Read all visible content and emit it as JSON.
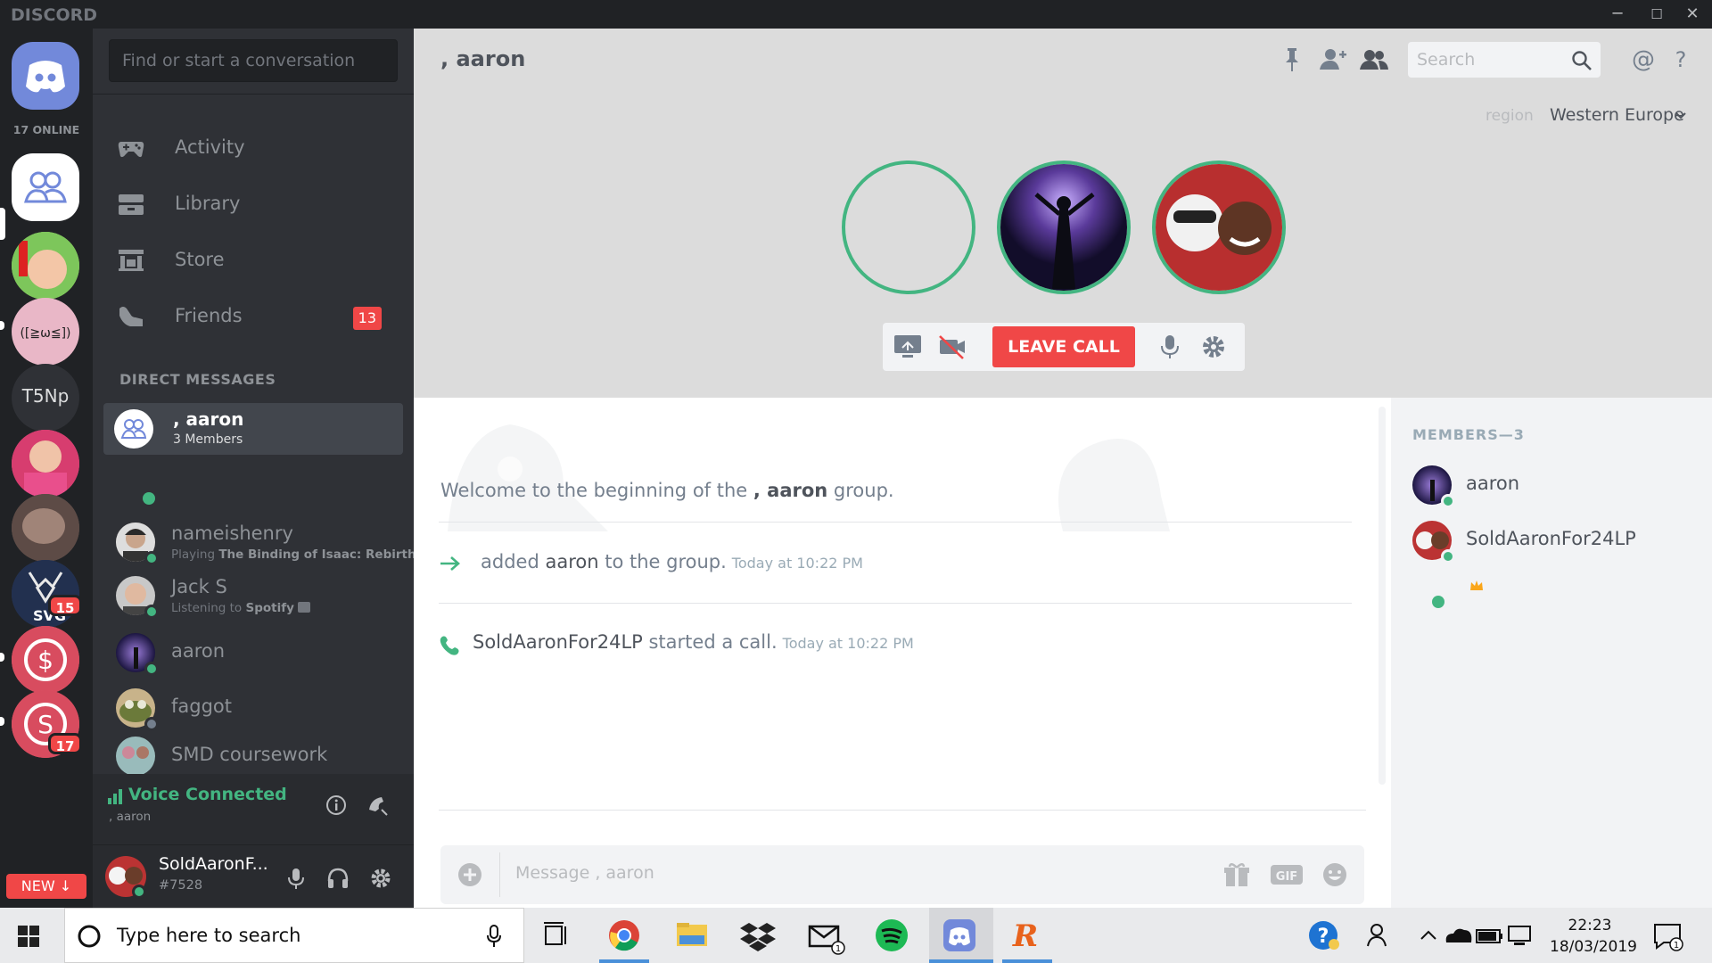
{
  "app": {
    "brand": "DISCORD",
    "online_count": "17 ONLINE"
  },
  "window": {
    "minimize": "─",
    "maximize": "☐",
    "close": "✕"
  },
  "rail": {
    "t5np_label": "T5Np",
    "badge_svg": "15",
    "badge_last": "17",
    "new_label": "NEW ↓"
  },
  "sidebar": {
    "search_placeholder": "Find or start a conversation",
    "nav": [
      {
        "label": "Activity"
      },
      {
        "label": "Library"
      },
      {
        "label": "Store"
      },
      {
        "label": "Friends",
        "count": "13"
      }
    ],
    "dm_heading": "DIRECT MESSAGES",
    "active_dm": {
      "name": ", aaron",
      "sub": "3 Members"
    },
    "dms": [
      {
        "name": "nameishenry",
        "sub_prefix": "Playing ",
        "sub_bold": "The Binding of Isaac: Rebirth",
        "status": "#43b581"
      },
      {
        "name": "Jack S",
        "sub_prefix": "Listening to ",
        "sub_bold": "Spotify",
        "status": "#43b581"
      },
      {
        "name": "aaron",
        "status": "#43b581"
      },
      {
        "name": "faggot",
        "status": "#747f8d"
      },
      {
        "name": "SMD coursework"
      }
    ]
  },
  "voice": {
    "status": "Voice Connected",
    "channel": ", aaron"
  },
  "user": {
    "name": "SoldAaronF...",
    "tag": "#7528"
  },
  "call": {
    "title": ", aaron",
    "search_placeholder": "Search",
    "region_label": "region",
    "region_value": "Western Europe",
    "leave_label": "LEAVE CALL"
  },
  "chat": {
    "welcome_prefix": "Welcome to the beginning of the ",
    "welcome_group": ", aaron",
    "welcome_suffix": " group.",
    "messages": [
      {
        "prefix": "added ",
        "who": "aaron",
        "text": " to the group.",
        "time": "Today at 10:22 PM"
      },
      {
        "who": "SoldAaronFor24LP",
        "text": " started a call.",
        "time": "Today at 10:22 PM"
      }
    ],
    "composer_placeholder": "Message , aaron"
  },
  "members": {
    "heading": "MEMBERS—3",
    "list": [
      {
        "name": "aaron"
      },
      {
        "name": "SoldAaronFor24LP"
      }
    ]
  },
  "taskbar": {
    "search_placeholder": "Type here to search",
    "time": "22:23",
    "date": "18/03/2019",
    "mail_count": "1",
    "notif_count": "1"
  },
  "colors": {
    "blurple": "#7289da",
    "green": "#43b581",
    "red": "#f04747"
  }
}
